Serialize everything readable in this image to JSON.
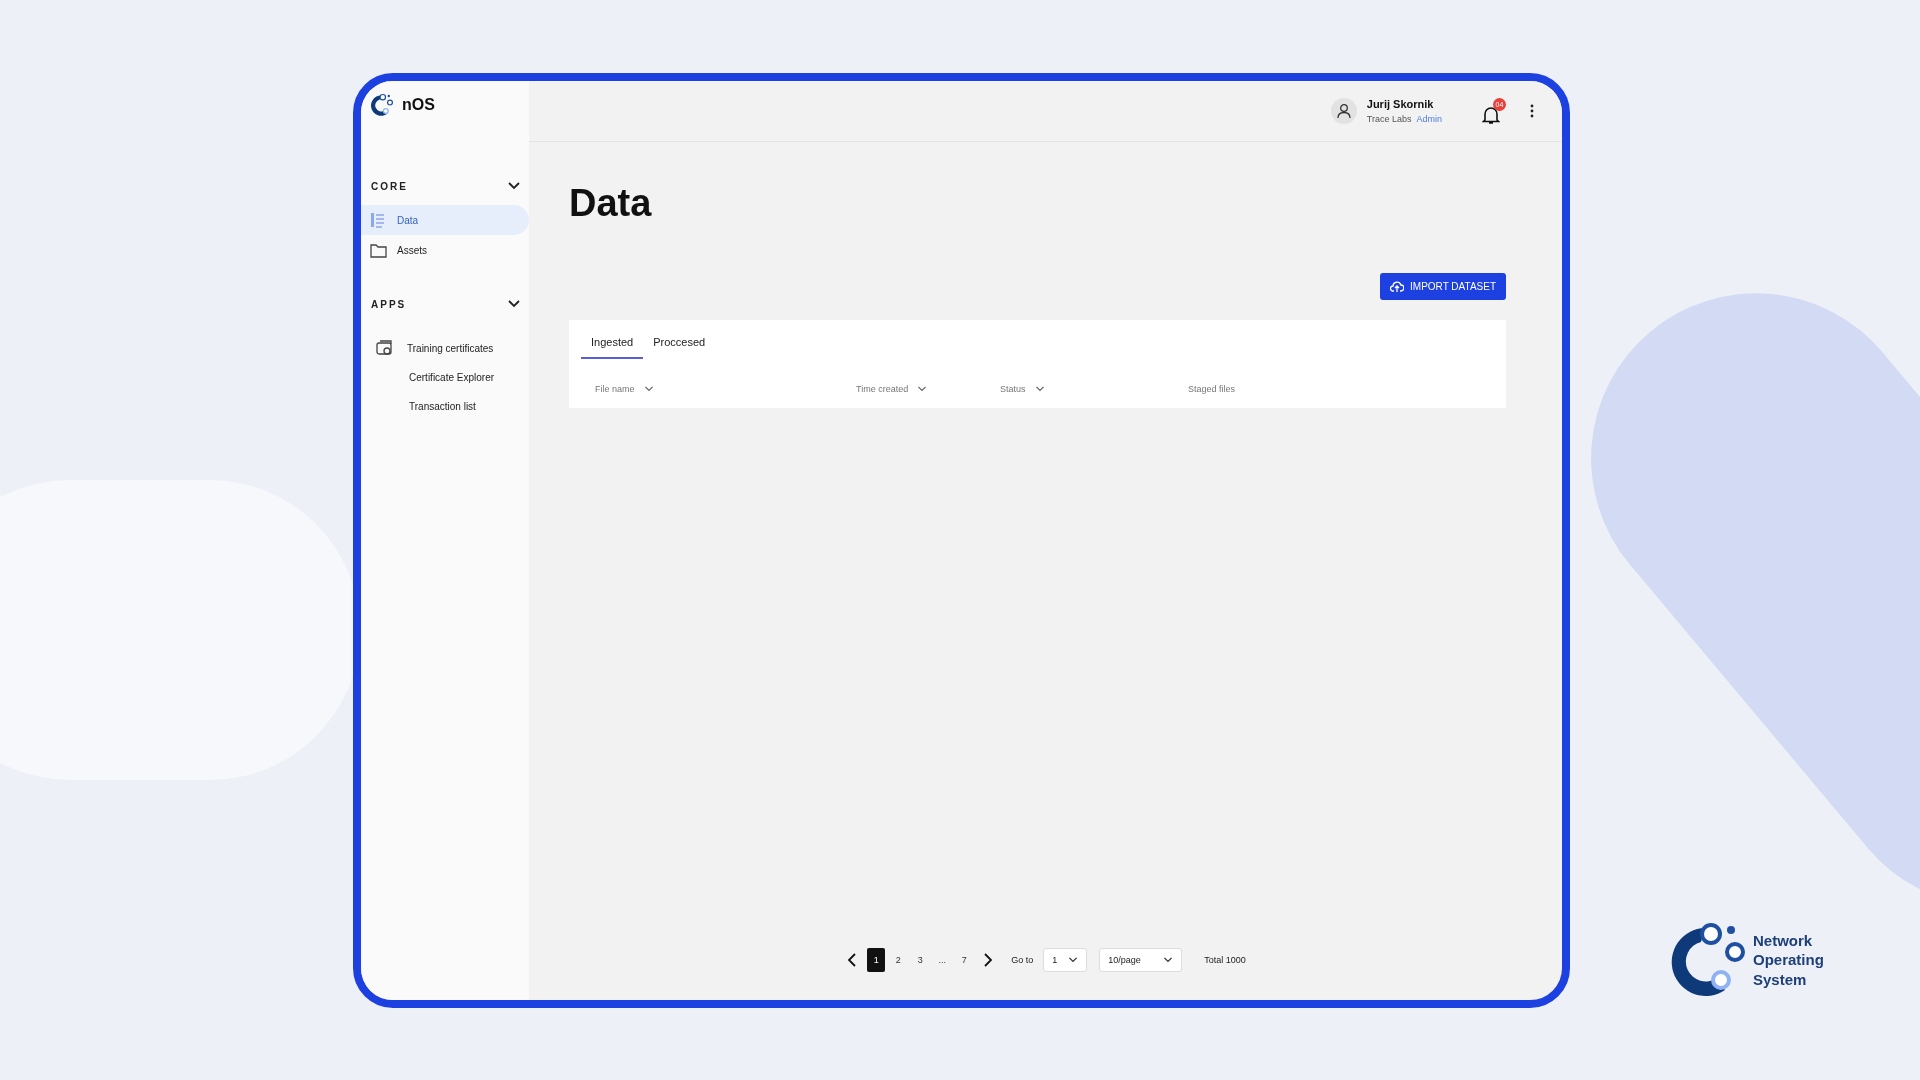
{
  "app": {
    "name": "nOS"
  },
  "sidebar": {
    "sections": [
      {
        "title": "CORE",
        "expanded": true,
        "items": [
          {
            "label": "Data",
            "selected": true
          },
          {
            "label": "Assets",
            "selected": false
          }
        ]
      },
      {
        "title": "APPS",
        "expanded": true,
        "items": [
          {
            "label": "Training certificates",
            "selected": false,
            "children": [
              {
                "label": "Certificate Explorer",
                "selected": false
              },
              {
                "label": "Transaction list",
                "selected": false
              }
            ]
          }
        ]
      }
    ]
  },
  "header": {
    "user": {
      "name": "Jurij Skornik",
      "org": "Trace Labs",
      "role": "Admin"
    },
    "notifications": {
      "count": "04"
    }
  },
  "page": {
    "title": "Data",
    "import_button": "IMPORT DATASET",
    "tabs": [
      {
        "label": "Ingested",
        "selected": true
      },
      {
        "label": "Proccesed",
        "selected": false
      }
    ],
    "table": {
      "columns": [
        {
          "label": "File name",
          "sortable": true
        },
        {
          "label": "Time created",
          "sortable": true
        },
        {
          "label": "Status",
          "sortable": true
        },
        {
          "label": "Staged files",
          "sortable": false
        }
      ]
    },
    "pagination": {
      "pages": [
        {
          "label": "1",
          "selected": true
        },
        {
          "label": "2",
          "selected": false
        },
        {
          "label": "3",
          "selected": false
        },
        {
          "label": "...",
          "selected": false
        },
        {
          "label": "7",
          "selected": false
        }
      ],
      "goto_label": "Go to",
      "goto_value": "1",
      "page_size": "10/page",
      "total": "Total 1000"
    }
  },
  "brand": {
    "text": "Network Operating System"
  }
}
